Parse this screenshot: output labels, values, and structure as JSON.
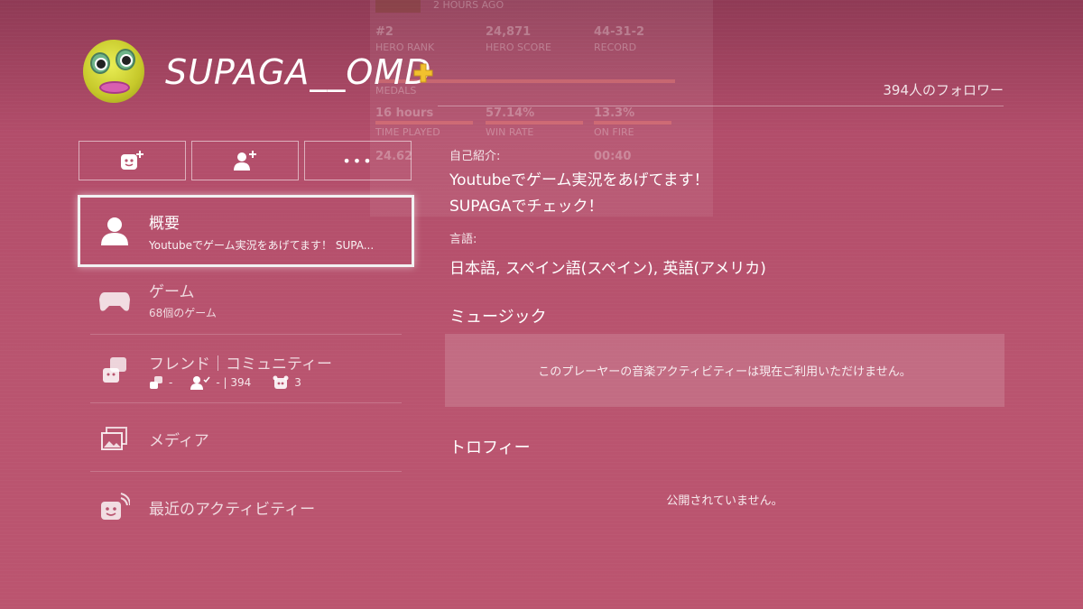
{
  "ghost_card": {
    "time_ago": "2 HOURS AGO",
    "stats_row1": [
      {
        "value": "#2",
        "label": "HERO RANK"
      },
      {
        "value": "24,871",
        "label": "HERO SCORE"
      },
      {
        "value": "44-31-2",
        "label": "RECORD"
      }
    ],
    "medals_label": "MEDALS",
    "stats_row2": [
      {
        "value": "16 hours",
        "label": "TIME PLAYED"
      },
      {
        "value": "57.14%",
        "label": "WIN RATE"
      },
      {
        "value": "13.3%",
        "label": "ON FIRE"
      }
    ],
    "stats_row3": [
      {
        "value": "24.62"
      },
      {
        "value": "00:40"
      }
    ]
  },
  "profile": {
    "username": "SUPAGA__OMD",
    "followers": "394人のフォロワー"
  },
  "actions": [
    {
      "icon": "add-friend-icon"
    },
    {
      "icon": "follow-icon"
    },
    {
      "label": "•••"
    }
  ],
  "nav": [
    {
      "title": "概要",
      "subtitle": "Youtubeでゲーム実況をあげてます！ SUPA...",
      "icon": "person-icon"
    },
    {
      "title": "ゲーム",
      "subtitle": "68個のゲーム",
      "icon": "controller-icon"
    },
    {
      "title": "フレンド｜コミュニティー",
      "friends": "-",
      "follow": "- | 394",
      "communities": "3",
      "icon": "friends-icon"
    },
    {
      "title": "メディア",
      "icon": "media-icon"
    },
    {
      "title": "最近のアクティビティー",
      "icon": "activity-icon"
    }
  ],
  "about": {
    "bio_label": "自己紹介:",
    "bio_line1": "Youtubeでゲーム実況をあげてます！",
    "bio_line2": "SUPAGAでチェック！",
    "lang_label": "言語:",
    "languages": "日本語, スペイン語(スペイン), 英語(アメリカ)"
  },
  "music": {
    "title": "ミュージック",
    "message": "このプレーヤーの音楽アクティビティーは現在ご利用いただけません。"
  },
  "trophies": {
    "title": "トロフィー",
    "message": "公開されていません。"
  },
  "colors": {
    "background": "#b9546f",
    "plus_gold": "#f2c12e"
  }
}
